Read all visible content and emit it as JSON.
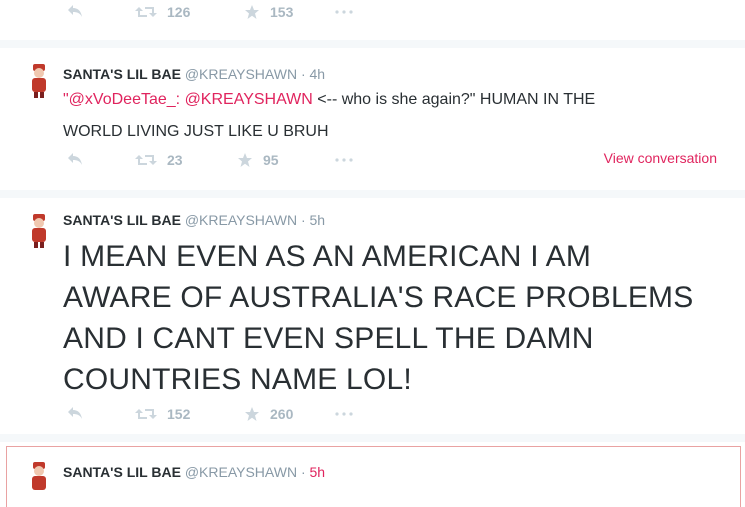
{
  "tweet0": {
    "retweets": "126",
    "favorites": "153"
  },
  "tweet1": {
    "name": "SANTA'S LIL BAE",
    "handle": "@KREAYSHAWN",
    "dot": "·",
    "time": "4h",
    "quote_mention_1": "\"@xVoDeeTae_:",
    "quote_mention_2": "@KREAYSHAWN",
    "text_rest_line1": " <-- who is she again?\" HUMAN IN THE",
    "text_line2": "WORLD LIVING JUST LIKE U BRUH",
    "retweets": "23",
    "favorites": "95",
    "view_conversation": "View conversation"
  },
  "tweet2": {
    "name": "SANTA'S LIL BAE",
    "handle": "@KREAYSHAWN",
    "dot": "·",
    "time": "5h",
    "lines": [
      "I MEAN EVEN AS AN AMERICAN I AM",
      "AWARE OF AUSTRALIA'S RACE PROBLEMS",
      "AND I CANT EVEN SPELL THE DAMN",
      "COUNTRIES NAME LOL!"
    ],
    "retweets": "152",
    "favorites": "260"
  },
  "tweet3": {
    "name": "SANTA'S LIL BAE",
    "handle": "@KREAYSHAWN",
    "dot": "·",
    "time": "5h"
  },
  "colors": {
    "accent": "#e0245e",
    "muted": "#8899a6",
    "action": "#aab8c2",
    "separator": "#f5f8fa"
  },
  "icons": [
    "reply-icon",
    "retweet-icon",
    "favorite-icon",
    "more-icon",
    "avatar"
  ]
}
